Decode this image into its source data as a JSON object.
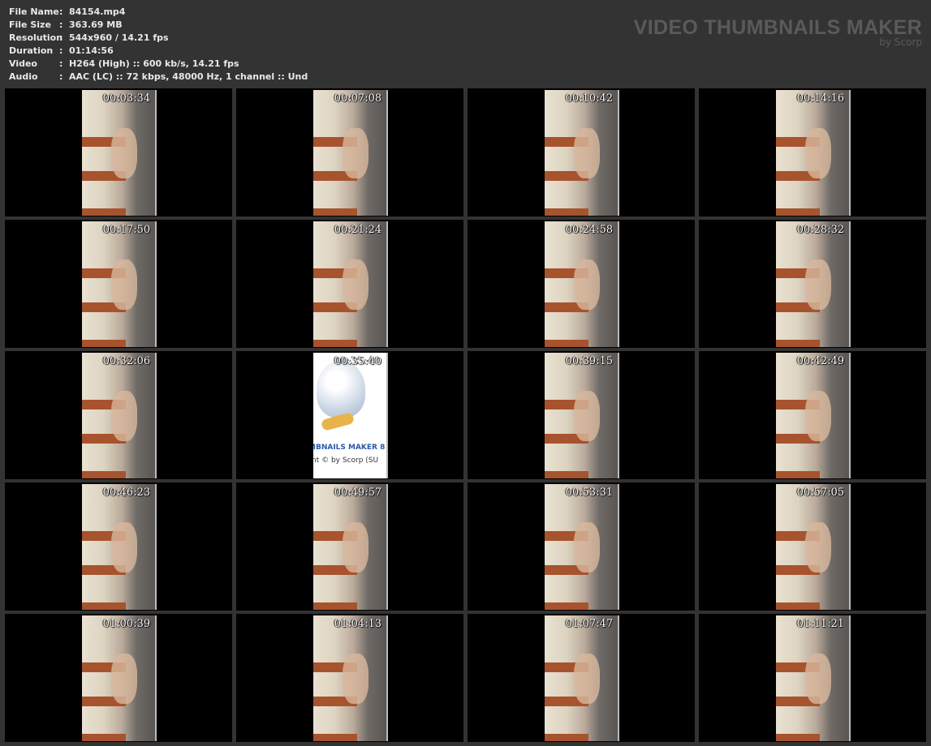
{
  "info": [
    {
      "key": "File Name",
      "value": "84154.mp4"
    },
    {
      "key": "File Size",
      "value": "363.69 MB"
    },
    {
      "key": "Resolution",
      "value": "544x960 / 14.21 fps"
    },
    {
      "key": "Duration",
      "value": "01:14:56"
    },
    {
      "key": "Video",
      "value": "H264 (High) :: 600 kb/s, 14.21 fps"
    },
    {
      "key": "Audio",
      "value": "AAC (LC) :: 72 kbps, 48000 Hz, 1 channel :: Und"
    }
  ],
  "separator": ":",
  "brand": {
    "title": "VIDEO THUMBNAILS MAKER",
    "subtitle": "by Scorp"
  },
  "thumbnails": [
    "00:03:34",
    "00:07:08",
    "00:10:42",
    "00:14:16",
    "00:17:50",
    "00:21:24",
    "00:24:58",
    "00:28:32",
    "00:32:06",
    "00:35:40",
    "00:39:15",
    "00:42:49",
    "00:46:23",
    "00:49:57",
    "00:53:31",
    "00:57:05",
    "01:00:39",
    "01:04:13",
    "01:07:47",
    "01:11:21"
  ],
  "logo_frame": {
    "index": 9,
    "line1": "MBNAILS MAKER 8",
    "line2": "nt © by Scorp (SU"
  }
}
